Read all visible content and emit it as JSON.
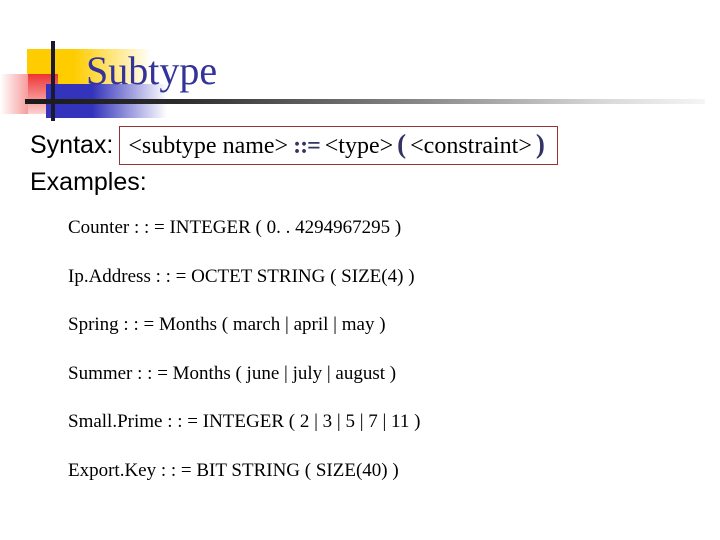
{
  "slide": {
    "title": "Subtype",
    "title_color": "#333399",
    "background": "#ffffff"
  },
  "ornament": {
    "gold_color": "#ffcc00",
    "red_color": "#ee3333",
    "blue_color": "#3333bb",
    "rule_color": "#1a1a1a",
    "vrule_color": "#1a1a33",
    "names": {
      "gold": "gold-square",
      "red": "red-square",
      "blue": "blue-square",
      "vrule": "vertical-rule",
      "hrule": "horizontal-rule"
    }
  },
  "syntax": {
    "label": "Syntax:",
    "box_border_color": "#993333",
    "operator_color": "#333366",
    "tokens": {
      "subtype_name": "<subtype name>",
      "assign": "::=",
      "type": "<type>",
      "paren_open": "(",
      "constraint": "<constraint>",
      "paren_close": ")"
    }
  },
  "examples": {
    "label": "Examples:",
    "items": [
      {
        "text": "Counter : : = INTEGER ( 0. . 4294967295 )"
      },
      {
        "text": "Ip.Address : : = OCTET STRING ( SIZE(4) )"
      },
      {
        "text": "Spring : : = Months ( march | april | may )"
      },
      {
        "text": "Summer : : = Months ( june | july | august )"
      },
      {
        "text": "Small.Prime : : = INTEGER ( 2 | 3 | 5 | 7 | 11 )"
      },
      {
        "text": "Export.Key : : = BIT STRING ( SIZE(40) )"
      }
    ]
  }
}
